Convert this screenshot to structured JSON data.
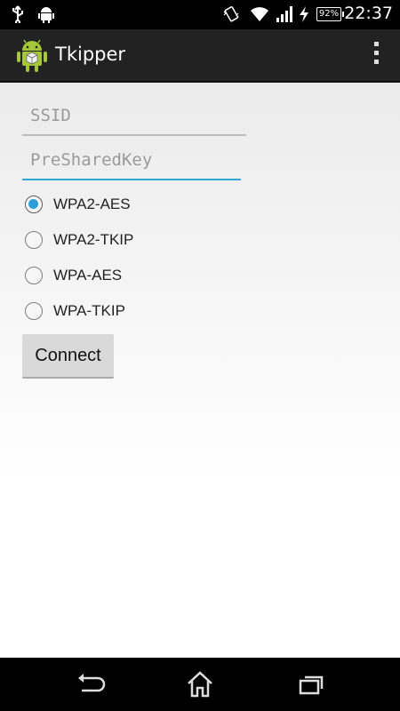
{
  "status_bar": {
    "time": "22:37",
    "battery": "92%",
    "icons": [
      "usb-icon",
      "android-notification-icon",
      "vibrate-icon",
      "wifi-icon",
      "signal-icon",
      "charging-icon",
      "battery-icon"
    ]
  },
  "action_bar": {
    "title": "Tkipper",
    "app_icon": "android-app-icon",
    "overflow_icon": "overflow-menu-icon"
  },
  "form": {
    "ssid_placeholder": "SSID",
    "ssid_value": "",
    "psk_placeholder": "PreSharedKey",
    "psk_value": "",
    "options": [
      {
        "label": "WPA2-AES",
        "checked": true
      },
      {
        "label": "WPA2-TKIP",
        "checked": false
      },
      {
        "label": "WPA-AES",
        "checked": false
      },
      {
        "label": "WPA-TKIP",
        "checked": false
      }
    ],
    "connect_label": "Connect"
  },
  "nav_bar": {
    "icons": [
      "back-icon",
      "home-icon",
      "recents-icon"
    ]
  },
  "colors": {
    "accent": "#33a7dc",
    "radio_fill": "#2e9ed6",
    "action_bar": "#222222"
  }
}
